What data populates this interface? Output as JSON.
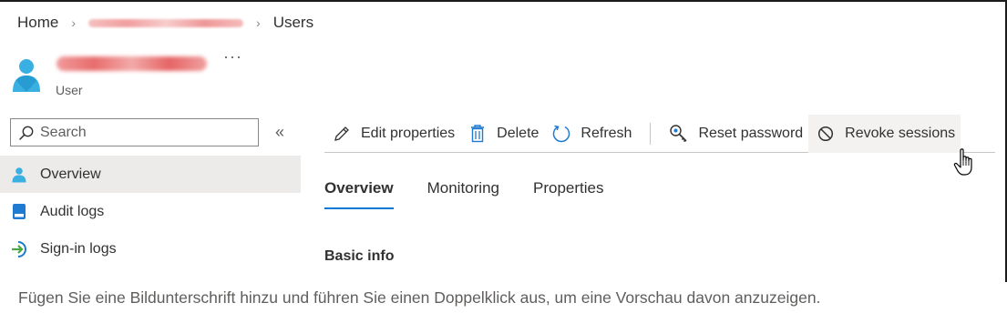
{
  "breadcrumb": {
    "items": [
      "Home",
      "Users"
    ],
    "redacted_segment": true
  },
  "header": {
    "subtitle": "User",
    "more_label": "···"
  },
  "sidebar": {
    "search_placeholder": "Search",
    "collapse_label": "«",
    "items": [
      {
        "label": "Overview",
        "icon": "user-icon",
        "active": true
      },
      {
        "label": "Audit logs",
        "icon": "audit-log-icon",
        "active": false
      },
      {
        "label": "Sign-in logs",
        "icon": "sign-in-icon",
        "active": false
      }
    ]
  },
  "toolbar": {
    "edit_label": "Edit properties",
    "delete_label": "Delete",
    "refresh_label": "Refresh",
    "reset_label": "Reset password",
    "revoke_label": "Revoke sessions"
  },
  "tabs": [
    "Overview",
    "Monitoring",
    "Properties"
  ],
  "main": {
    "section_title": "Basic info"
  },
  "caption": "Fügen Sie eine Bildunterschrift hinzu und führen Sie einen Doppelklick aus, um eine Vorschau davon anzuzeigen.",
  "colors": {
    "accent": "#0078d4",
    "active_nav_bg": "#edebe9",
    "text": "#323130"
  }
}
